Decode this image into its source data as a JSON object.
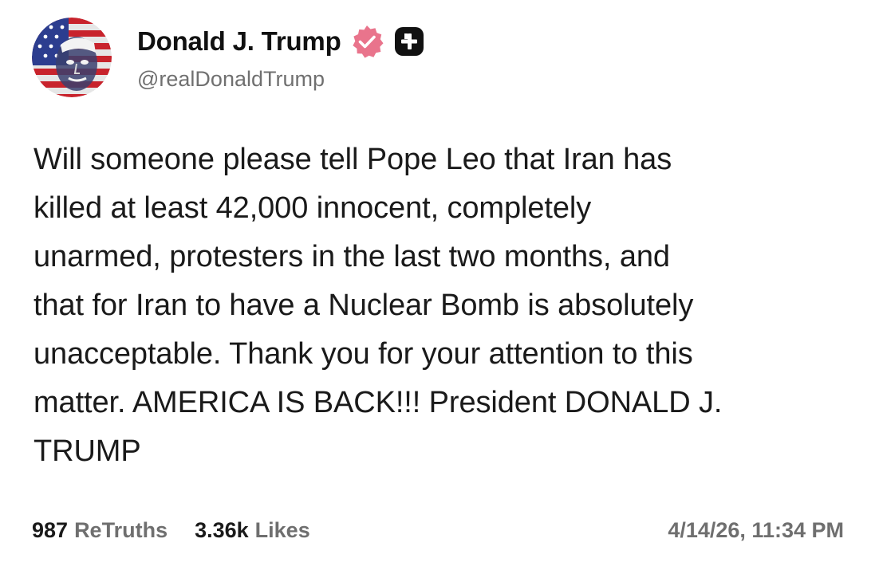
{
  "post": {
    "author": {
      "display_name": "Donald J. Trump",
      "handle": "@realDonaldTrump",
      "verified_icon": "verified-badge-icon",
      "badge_icon": "plus-icon"
    },
    "text": "Will someone please tell Pope Leo that Iran has\nkilled at least 42,000 innocent, completely\nunarmed, protesters in the last two months, and\nthat for Iran to have a Nuclear Bomb is absolutely\nunacceptable. Thank you for your attention to this\nmatter. AMERICA IS BACK!!! President DONALD J.\nTRUMP",
    "stats": {
      "retruths_count": "987",
      "retruths_label": "ReTruths",
      "likes_count": "3.36k",
      "likes_label": "Likes"
    },
    "timestamp": "4/14/26, 11:34 PM"
  },
  "colors": {
    "verified_badge": "#E9748C",
    "plus_badge_bg": "#111111",
    "plus_badge_fg": "#ffffff",
    "secondary_text": "#6f6f6f"
  }
}
